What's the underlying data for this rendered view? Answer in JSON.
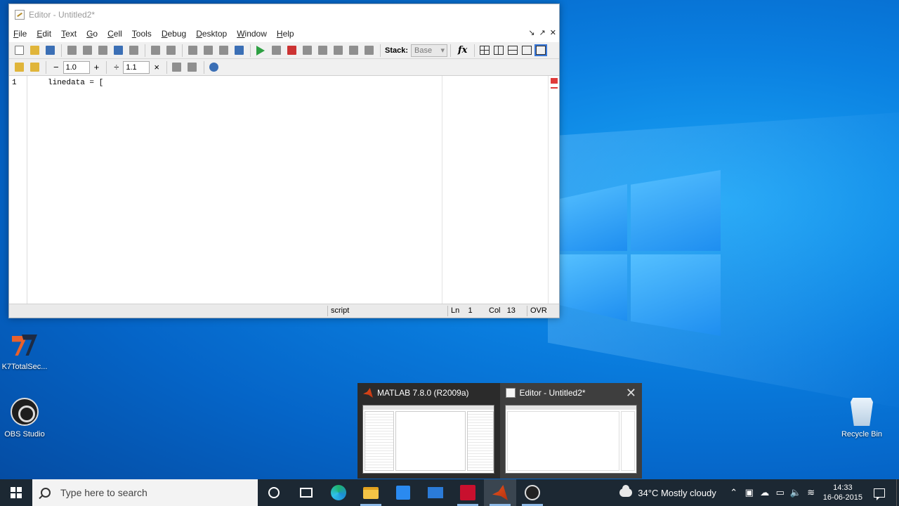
{
  "editor": {
    "title": "Editor - Untitled2*",
    "menu": [
      "File",
      "Edit",
      "Text",
      "Go",
      "Cell",
      "Tools",
      "Debug",
      "Desktop",
      "Window",
      "Help"
    ],
    "window_controls": [
      "↘",
      "↗",
      "✕"
    ],
    "toolbar": {
      "stack_label": "Stack:",
      "stack_value": "Base",
      "fx_label": "fx"
    },
    "cell_toolbar": {
      "minus": "−",
      "value1": "1.0",
      "plus": "+",
      "divide": "÷",
      "value2": "1.1",
      "times": "×"
    },
    "code": {
      "line_number": "1",
      "line_text": "linedata = ["
    },
    "status": {
      "mode": "script",
      "ln_label": "Ln",
      "ln_value": "1",
      "col_label": "Col",
      "col_value": "13",
      "ovr": "OVR"
    }
  },
  "desktop_icons": [
    {
      "label": "K7TotalSec...",
      "icon": "k7-icon"
    },
    {
      "label": "OBS Studio",
      "icon": "obs-icon"
    },
    {
      "label": "Recycle Bin",
      "icon": "recycle-bin-icon"
    }
  ],
  "task_preview": {
    "items": [
      {
        "title": "MATLAB  7.8.0 (R2009a)",
        "icon": "matlab-icon"
      },
      {
        "title": "Editor - Untitled2*",
        "icon": "document-icon",
        "close": "✕"
      }
    ]
  },
  "taskbar": {
    "search_placeholder": "Type here to search",
    "weather": "34°C  Mostly cloudy",
    "time": "14:33",
    "date": "16-06-2015"
  }
}
